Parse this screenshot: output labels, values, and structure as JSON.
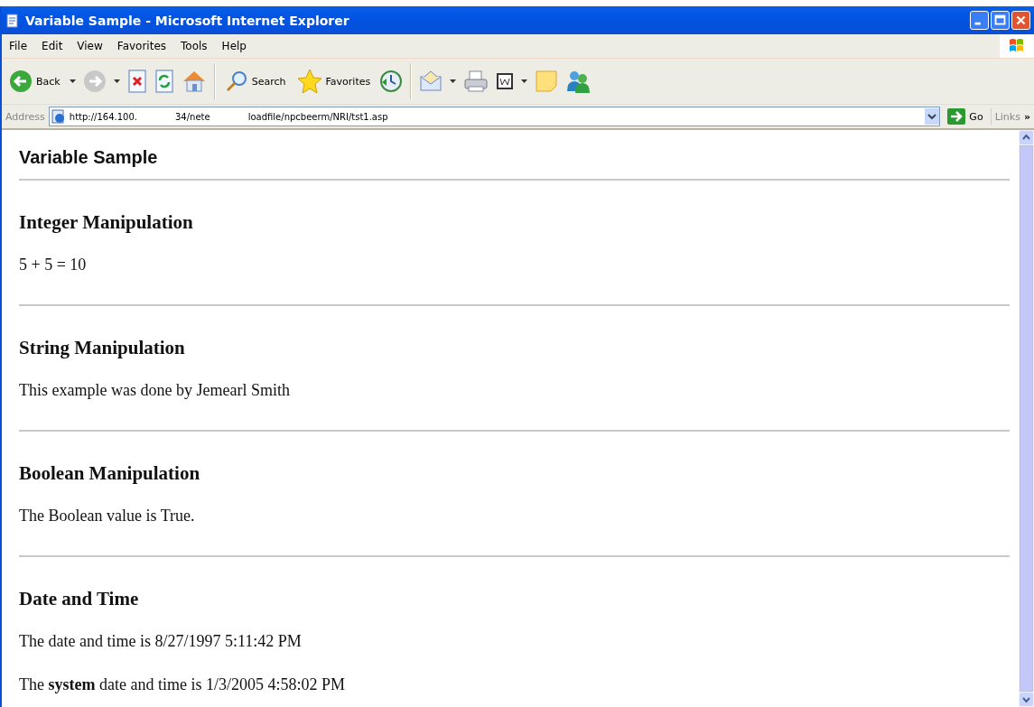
{
  "window": {
    "title": "Variable Sample - Microsoft Internet Explorer"
  },
  "menu": [
    "File",
    "Edit",
    "View",
    "Favorites",
    "Tools",
    "Help"
  ],
  "toolbar": [
    {
      "kind": "back",
      "label": "Back"
    },
    {
      "kind": "dropdown"
    },
    {
      "kind": "forward"
    },
    {
      "kind": "dropdown"
    },
    {
      "kind": "stop"
    },
    {
      "kind": "refresh"
    },
    {
      "kind": "home"
    },
    {
      "kind": "separator"
    },
    {
      "kind": "search",
      "label": "Search"
    },
    {
      "kind": "favorites",
      "label": "Favorites"
    },
    {
      "kind": "history"
    },
    {
      "kind": "separator"
    },
    {
      "kind": "mail"
    },
    {
      "kind": "dropdown"
    },
    {
      "kind": "print"
    },
    {
      "kind": "edit"
    },
    {
      "kind": "dropdown"
    },
    {
      "kind": "note"
    },
    {
      "kind": "messenger"
    }
  ],
  "address": {
    "label": "Address",
    "url_parts": [
      "http://164.100.",
      "34/nete",
      "loadfile/npcbeerm/NRI/tst1.asp"
    ],
    "go": "Go",
    "links": "Links",
    "more": "»"
  },
  "page": {
    "title": "Variable Sample",
    "sections": [
      {
        "heading": "Integer Manipulation",
        "paragraphs": [
          "5 + 5 = 10"
        ]
      },
      {
        "heading": "String Manipulation",
        "paragraphs": [
          "This example was done by Jemearl Smith"
        ]
      },
      {
        "heading": "Boolean Manipulation",
        "paragraphs": [
          "The Boolean value is True."
        ]
      },
      {
        "heading": "Date and Time",
        "paragraphs": [
          "The date and time is 8/27/1997 5:11:42 PM",
          "The **system** date and time is 1/3/2005 4:58:02 PM"
        ]
      }
    ]
  }
}
